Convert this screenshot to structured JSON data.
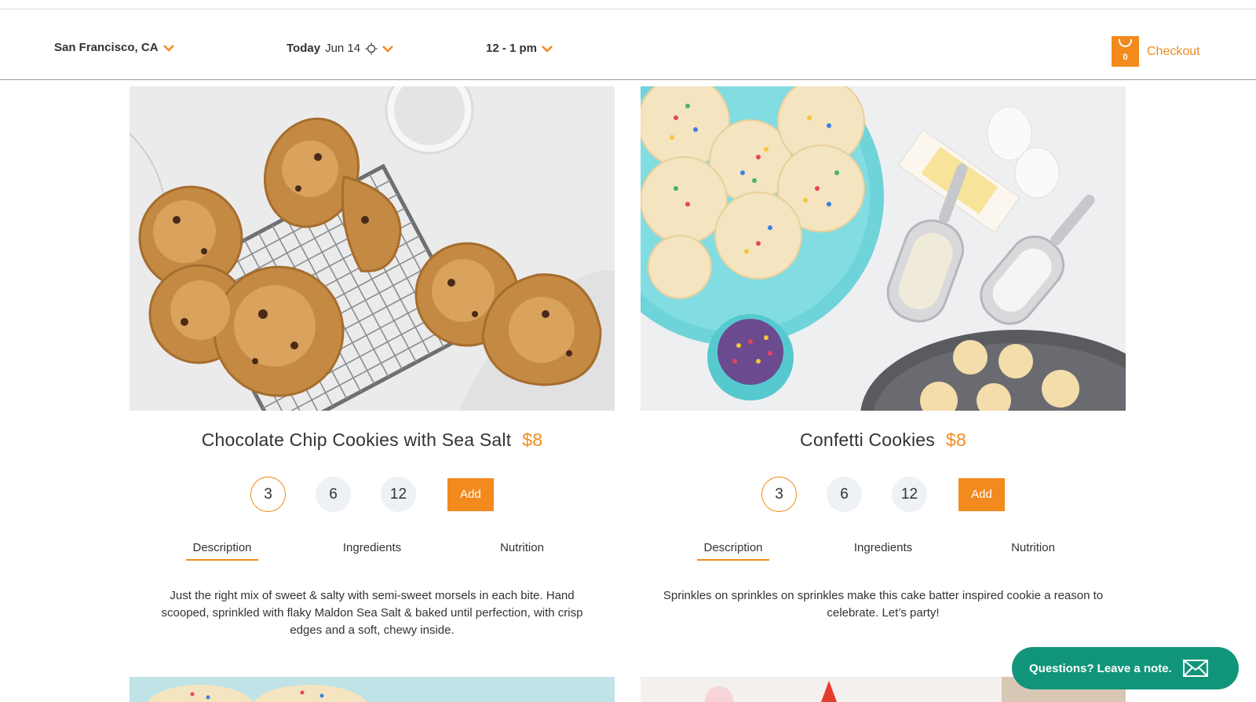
{
  "header": {
    "location": "San Francisco, CA",
    "date_day": "Today",
    "date_value": "Jun 14",
    "time_slot": "12 - 1 pm",
    "cart_count": "0",
    "checkout_label": "Checkout"
  },
  "products": [
    {
      "title": "Chocolate Chip Cookies with Sea Salt",
      "price": "$8",
      "quantities": [
        "3",
        "6",
        "12"
      ],
      "add_label": "Add",
      "tabs": [
        "Description",
        "Ingredients",
        "Nutrition"
      ],
      "description": "Just the right mix of sweet & salty with semi-sweet morsels in each bite. Hand scooped, sprinkled with flaky Maldon Sea Salt & baked until perfection, with crisp edges and a soft, chewy inside."
    },
    {
      "title": "Confetti Cookies",
      "price": "$8",
      "quantities": [
        "3",
        "6",
        "12"
      ],
      "add_label": "Add",
      "tabs": [
        "Description",
        "Ingredients",
        "Nutrition"
      ],
      "description": "Sprinkles on sprinkles on sprinkles make this cake batter inspired cookie a reason to celebrate. Let’s party!"
    }
  ],
  "help": {
    "label": "Questions? Leave a note."
  },
  "colors": {
    "accent": "#f28a1d",
    "help_bg": "#11957a"
  }
}
